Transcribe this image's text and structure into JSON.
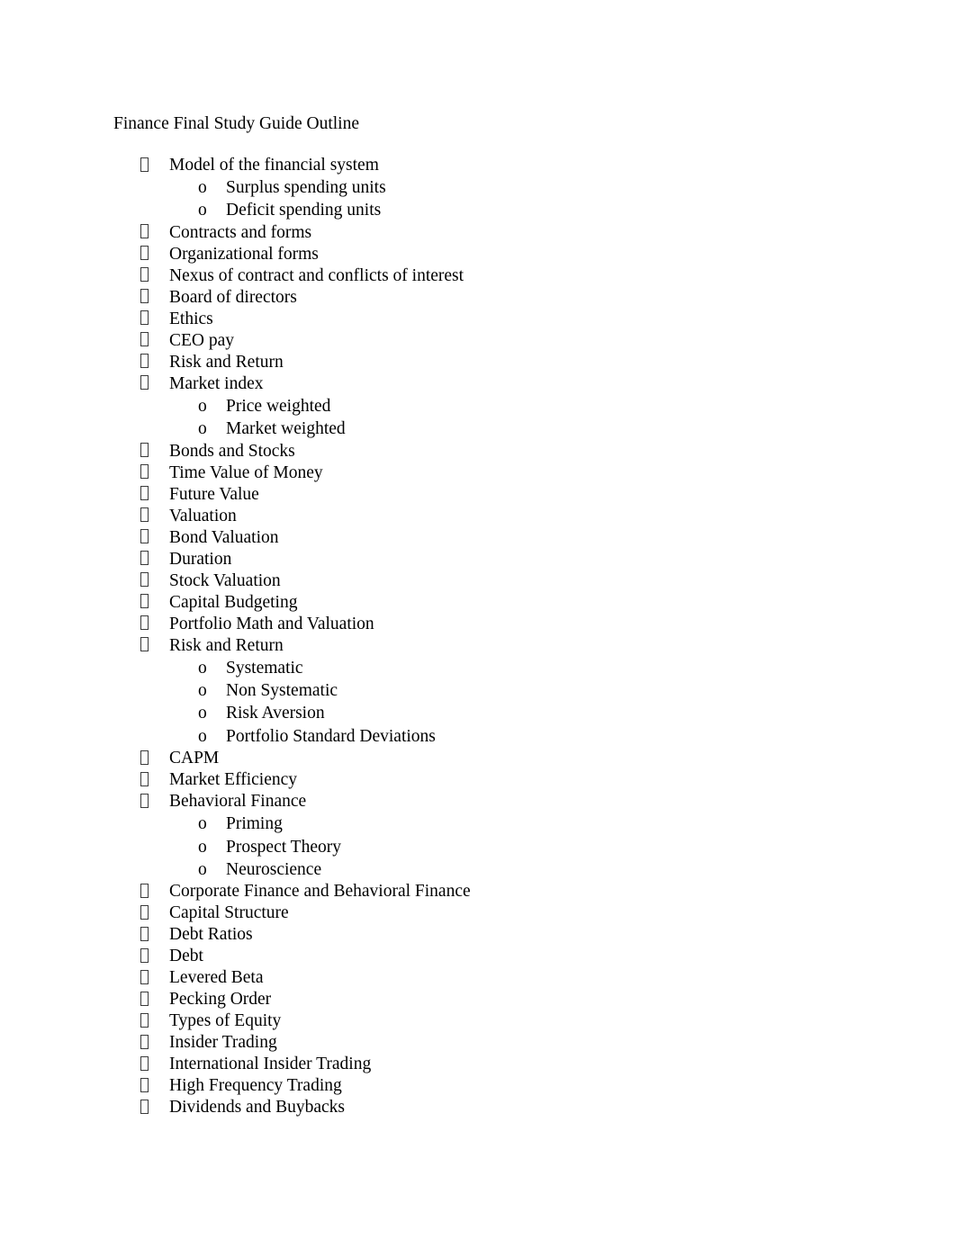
{
  "document": {
    "title": "Finance Final Study Guide Outline",
    "bullet_level1_glyph": "missing-glyph-box",
    "bullet_level2_glyph": "o",
    "text_color": "#000000",
    "background_color": "#ffffff",
    "outline": [
      {
        "level": 1,
        "text": "Model of the financial system"
      },
      {
        "level": 2,
        "text": "Surplus spending units"
      },
      {
        "level": 2,
        "text": "Deficit spending units"
      },
      {
        "level": 1,
        "text": "Contracts and forms"
      },
      {
        "level": 1,
        "text": "Organizational forms"
      },
      {
        "level": 1,
        "text": "Nexus of contract and conflicts of interest"
      },
      {
        "level": 1,
        "text": "Board of directors"
      },
      {
        "level": 1,
        "text": "Ethics"
      },
      {
        "level": 1,
        "text": "CEO pay"
      },
      {
        "level": 1,
        "text": "Risk and Return"
      },
      {
        "level": 1,
        "text": "Market index"
      },
      {
        "level": 2,
        "text": "Price weighted"
      },
      {
        "level": 2,
        "text": "Market weighted"
      },
      {
        "level": 1,
        "text": "Bonds and Stocks"
      },
      {
        "level": 1,
        "text": "Time Value of Money"
      },
      {
        "level": 1,
        "text": "Future Value"
      },
      {
        "level": 1,
        "text": "Valuation"
      },
      {
        "level": 1,
        "text": "Bond Valuation"
      },
      {
        "level": 1,
        "text": "Duration"
      },
      {
        "level": 1,
        "text": "Stock Valuation"
      },
      {
        "level": 1,
        "text": "Capital Budgeting"
      },
      {
        "level": 1,
        "text": "Portfolio Math and Valuation"
      },
      {
        "level": 1,
        "text": "Risk and Return"
      },
      {
        "level": 2,
        "text": "Systematic"
      },
      {
        "level": 2,
        "text": "Non Systematic"
      },
      {
        "level": 2,
        "text": "Risk Aversion"
      },
      {
        "level": 2,
        "text": "Portfolio Standard Deviations"
      },
      {
        "level": 1,
        "text": "CAPM"
      },
      {
        "level": 1,
        "text": "Market Efficiency"
      },
      {
        "level": 1,
        "text": "Behavioral Finance"
      },
      {
        "level": 2,
        "text": "Priming"
      },
      {
        "level": 2,
        "text": "Prospect Theory"
      },
      {
        "level": 2,
        "text": "Neuroscience"
      },
      {
        "level": 1,
        "text": "Corporate Finance and Behavioral Finance"
      },
      {
        "level": 1,
        "text": "Capital Structure"
      },
      {
        "level": 1,
        "text": "Debt Ratios"
      },
      {
        "level": 1,
        "text": "Debt"
      },
      {
        "level": 1,
        "text": "Levered Beta"
      },
      {
        "level": 1,
        "text": "Pecking Order"
      },
      {
        "level": 1,
        "text": "Types of Equity"
      },
      {
        "level": 1,
        "text": "Insider Trading"
      },
      {
        "level": 1,
        "text": "International Insider Trading"
      },
      {
        "level": 1,
        "text": "High Frequency Trading"
      },
      {
        "level": 1,
        "text": "Dividends and Buybacks"
      }
    ]
  }
}
